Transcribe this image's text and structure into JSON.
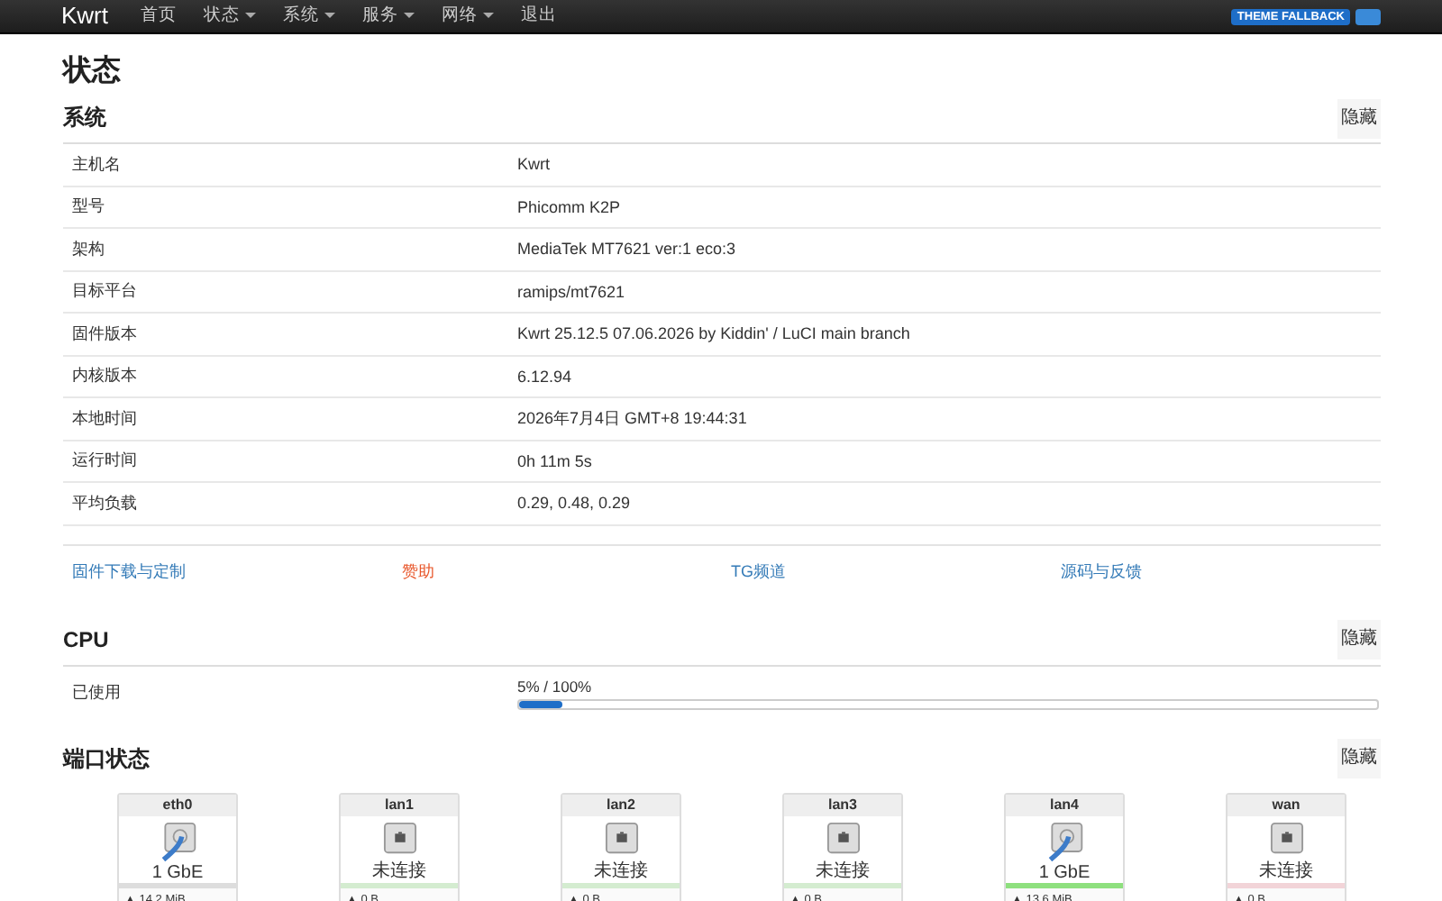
{
  "navbar": {
    "brand": "Kwrt",
    "menu": [
      {
        "label": "首页",
        "dropdown": false
      },
      {
        "label": "状态",
        "dropdown": true
      },
      {
        "label": "系统",
        "dropdown": true
      },
      {
        "label": "服务",
        "dropdown": true
      },
      {
        "label": "网络",
        "dropdown": true
      },
      {
        "label": "退出",
        "dropdown": false
      }
    ],
    "theme_badge": "THEME FALLBACK"
  },
  "page_title": "状态",
  "system": {
    "title": "系统",
    "hide_button": "隐藏",
    "rows": [
      {
        "key": "主机名",
        "value": "Kwrt"
      },
      {
        "key": "型号",
        "value": "Phicomm K2P"
      },
      {
        "key": "架构",
        "value": "MediaTek MT7621 ver:1 eco:3"
      },
      {
        "key": "目标平台",
        "value": "ramips/mt7621"
      },
      {
        "key": "固件版本",
        "value": "Kwrt 25.12.5 07.06.2026 by Kiddin' / LuCI main branch"
      },
      {
        "key": "内核版本",
        "value": "6.12.94"
      },
      {
        "key": "本地时间",
        "value": "2026年7月4日 GMT+8 19:44:31"
      },
      {
        "key": "运行时间",
        "value": "0h 11m 5s"
      },
      {
        "key": "平均负载",
        "value": "0.29, 0.48, 0.29"
      }
    ]
  },
  "links": [
    {
      "label": "固件下载与定制",
      "color": "#337ab7"
    },
    {
      "label": "赞助",
      "color": "#e8562a"
    },
    {
      "label": "TG频道",
      "color": "#337ab7"
    },
    {
      "label": "源码与反馈",
      "color": "#337ab7"
    }
  ],
  "cpu": {
    "title": "CPU",
    "hide_button": "隐藏",
    "label": "已使用",
    "reading": "5% / 100%",
    "level": 0.05
  },
  "ports": {
    "title": "端口状态",
    "hide_button": "隐藏",
    "items": [
      {
        "name": "eth0",
        "connected": true,
        "status": "1 GbE",
        "color": "#dddddd",
        "traffic": "▲ 14.2 MiB"
      },
      {
        "name": "lan1",
        "connected": false,
        "status": "未连接",
        "color": "#d4ecd0",
        "traffic": "▲ 0 B"
      },
      {
        "name": "lan2",
        "connected": false,
        "status": "未连接",
        "color": "#d4ecd0",
        "traffic": "▲ 0 B"
      },
      {
        "name": "lan3",
        "connected": false,
        "status": "未连接",
        "color": "#d4ecd0",
        "traffic": "▲ 0 B"
      },
      {
        "name": "lan4",
        "connected": true,
        "status": "1 GbE",
        "color": "#8ee07e",
        "traffic": "▲ 13.6 MiB"
      },
      {
        "name": "wan",
        "connected": false,
        "status": "未连接",
        "color": "#f2d4d8",
        "traffic": "▲ 0 B"
      }
    ]
  }
}
